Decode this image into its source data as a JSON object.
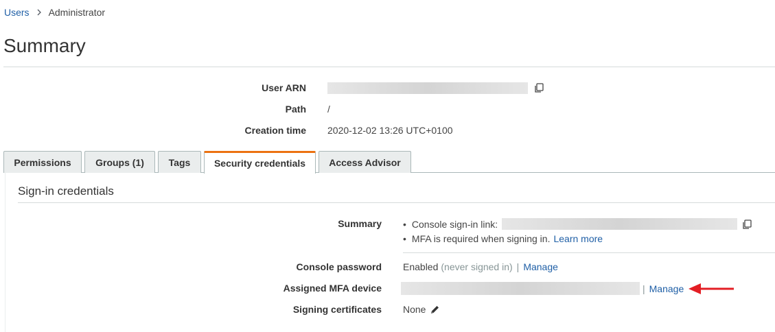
{
  "breadcrumb": {
    "parent": "Users",
    "current": "Administrator"
  },
  "page": {
    "title": "Summary"
  },
  "summary": {
    "user_arn_label": "User ARN",
    "path_label": "Path",
    "path_value": "/",
    "creation_label": "Creation time",
    "creation_value": "2020-12-02 13:26 UTC+0100"
  },
  "tabs": [
    {
      "label": "Permissions",
      "active": false
    },
    {
      "label": "Groups (1)",
      "active": false
    },
    {
      "label": "Tags",
      "active": false
    },
    {
      "label": "Security credentials",
      "active": true
    },
    {
      "label": "Access Advisor",
      "active": false
    }
  ],
  "signin": {
    "title": "Sign-in credentials",
    "summary_label": "Summary",
    "console_link_label": "Console sign-in link:",
    "mfa_required_text": "MFA is required when signing in.",
    "learn_more": "Learn more",
    "password_label": "Console password",
    "password_status": "Enabled",
    "password_note": "(never signed in)",
    "password_manage": "Manage",
    "mfa_label": "Assigned MFA device",
    "mfa_manage": "Manage",
    "cert_label": "Signing certificates",
    "cert_value": "None"
  },
  "colors": {
    "link": "#1f5fa6",
    "active_tab_accent": "#ec7211",
    "arrow": "#e31e24"
  },
  "icons": {
    "copy": "copy-icon",
    "edit": "pencil-icon",
    "chevron": "chevron-right-icon",
    "arrow": "arrow-left-icon"
  }
}
